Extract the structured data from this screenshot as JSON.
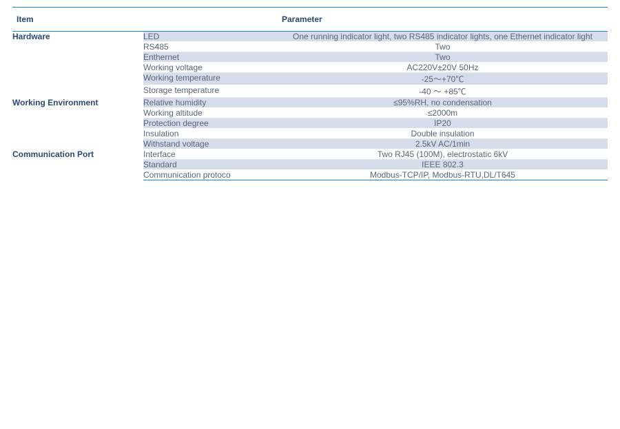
{
  "headers": {
    "item": "Item",
    "parameter": "Parameter"
  },
  "groups": [
    {
      "name": "Hardware",
      "rows": [
        {
          "label": "LED",
          "value": "One running indicator light, two RS485 indicator lights, one Ethernet indicator light",
          "shade": true
        },
        {
          "label": "RS485",
          "value": "Two",
          "shade": false
        },
        {
          "label": "Enthernet",
          "value": "Two",
          "shade": true
        },
        {
          "label": "Working voltage",
          "value": "AC220V±20V 50Hz",
          "shade": false
        },
        {
          "label": "Working temperature",
          "value": "-25～+70℃",
          "shade": true
        },
        {
          "label": "Storage temperature",
          "value": "-40 ～ +85℃",
          "shade": false
        }
      ]
    },
    {
      "name": "Working Environment",
      "rows": [
        {
          "label": "Relative humidity",
          "value": "≤95%RH, no condensation",
          "shade": true
        },
        {
          "label": "Working altitude",
          "value": "≤2000m",
          "shade": false
        },
        {
          "label": "Protection degree",
          "value": "IP20",
          "shade": true
        },
        {
          "label": "Insulation",
          "value": "Double insulation",
          "shade": false
        },
        {
          "label": "Withstand voltage",
          "value": "2.5kV AC/1min",
          "shade": true
        }
      ]
    },
    {
      "name": "Communication Port",
      "rows": [
        {
          "label": "Interface",
          "value": "Two RJ45 (100M), electrostatic 6kV",
          "shade": false
        },
        {
          "label": "Standard",
          "value": "IEEE 802.3",
          "shade": true
        },
        {
          "label": "Communication protoco",
          "value": "Modbus-TCP/IP, Modbus-RTU,DL/T645",
          "shade": false
        }
      ]
    }
  ]
}
